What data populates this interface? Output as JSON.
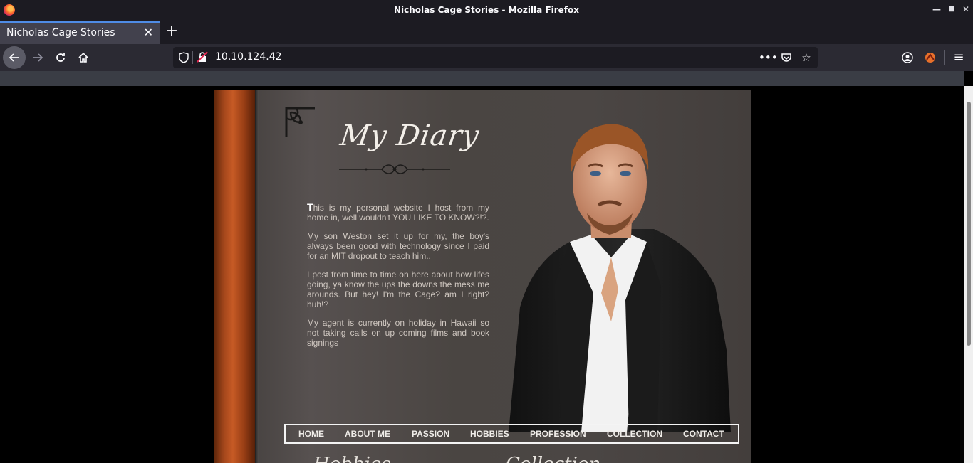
{
  "window": {
    "title": "Nicholas Cage Stories - Mozilla Firefox"
  },
  "tabs": [
    {
      "label": "Nicholas Cage Stories",
      "active": true
    }
  ],
  "toolbar": {
    "url": "10.10.124.42"
  },
  "page": {
    "title": "My Diary",
    "dropcap": "T",
    "paragraphs": [
      "his is my personal website I host from my home in, well wouldn't YOU LIKE TO KNOW?!?.",
      "My son Weston set it up for my, the boy's always been good with technology since I paid for an MIT dropout to teach him..",
      "I post from time to time on here about how lifes going, ya know the ups the downs the mess me arounds. But hey! I'm the Cage? am I right? huh!?",
      "My agent is currently on holiday in Hawaii so not taking calls on up coming films and book signings"
    ],
    "menu": [
      "HOME",
      "ABOUT ME",
      "PASSION",
      "HOBBIES",
      "PROFESSION",
      "COLLECTION",
      "CONTACT"
    ],
    "bottom_headings": [
      "Hobbies",
      "Collection"
    ]
  },
  "colors": {
    "spine": "#a6481c",
    "page": "#4a4542",
    "menu_border": "#f4f4f4",
    "chrome": "#1c1b22"
  }
}
